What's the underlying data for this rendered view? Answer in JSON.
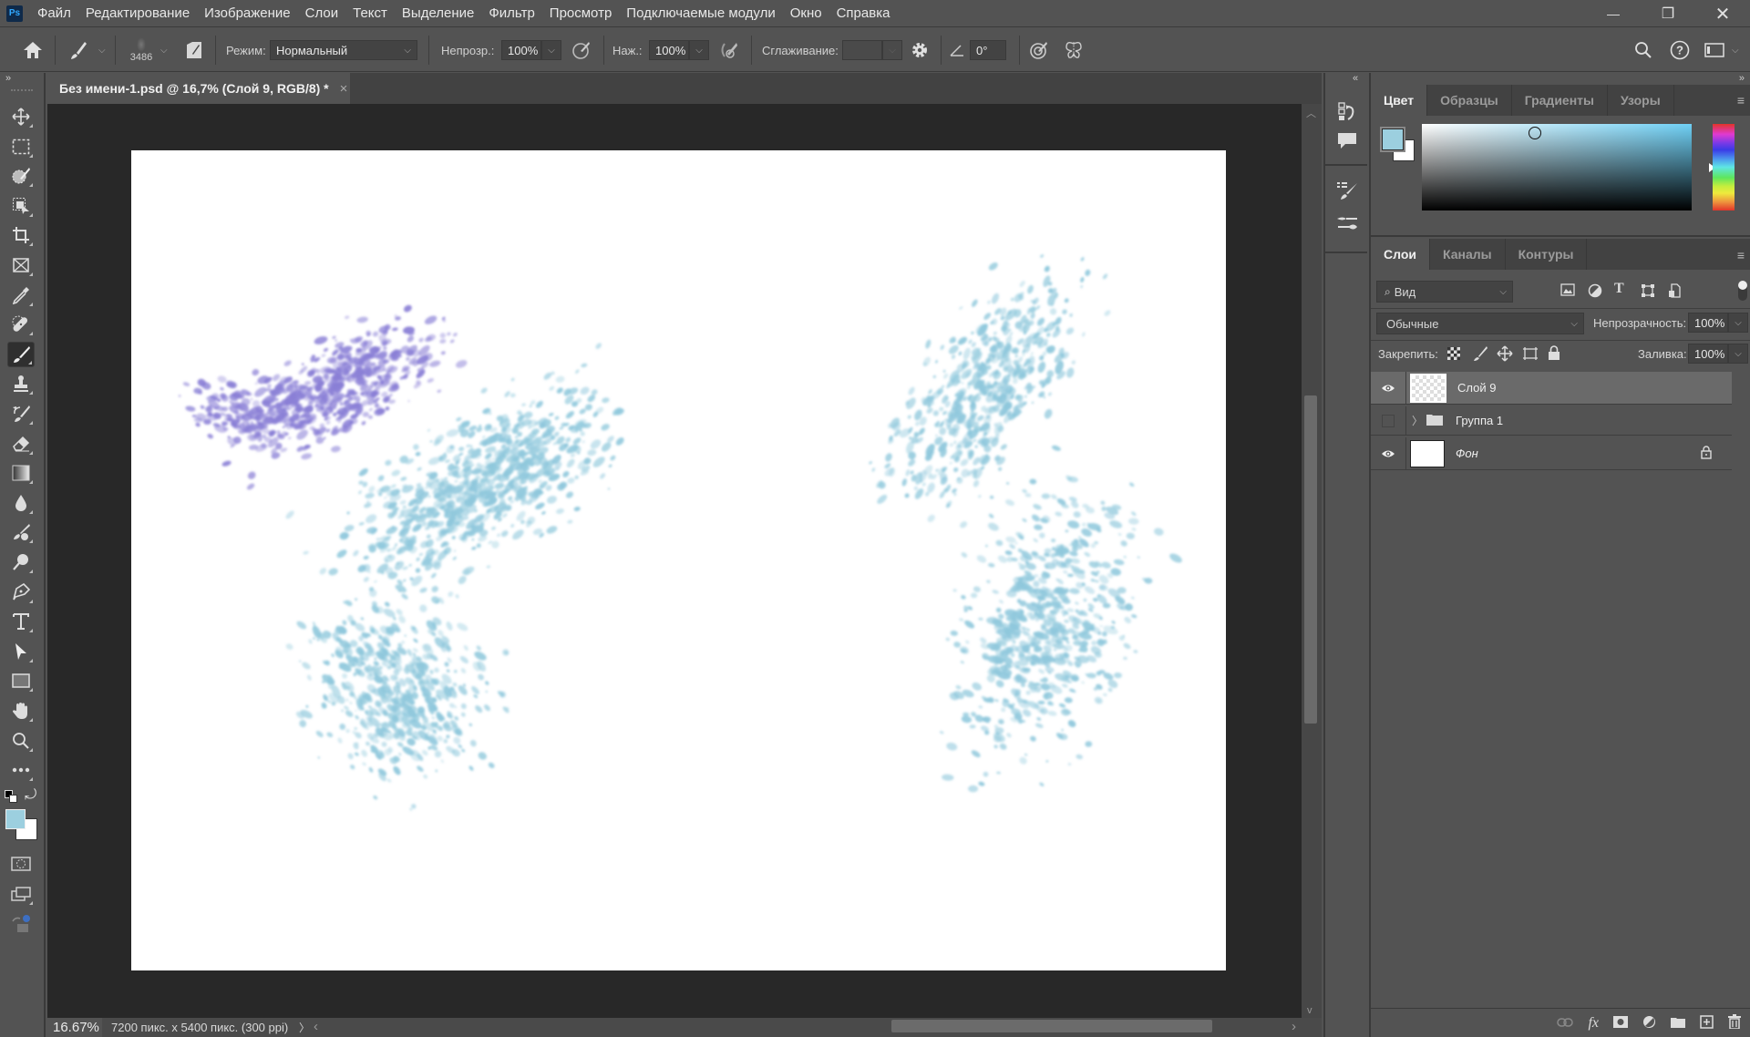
{
  "app": {
    "logo": "Ps"
  },
  "menu": [
    "Файл",
    "Редактирование",
    "Изображение",
    "Слои",
    "Текст",
    "Выделение",
    "Фильтр",
    "Просмотр",
    "Подключаемые модули",
    "Окно",
    "Справка"
  ],
  "window_controls": {
    "minimize": "—",
    "restore": "❐",
    "close": "✕"
  },
  "options_bar": {
    "brush_size": "3486",
    "mode_label": "Режим:",
    "mode_value": "Нормальный",
    "opacity_label": "Непрозр.:",
    "opacity_value": "100%",
    "flow_label": "Наж.:",
    "flow_value": "100%",
    "smoothing_label": "Сглаживание:",
    "smoothing_value": "",
    "angle_value": "0°"
  },
  "document": {
    "tab_title": "Без имени-1.psd @ 16,7% (Слой 9, RGB/8) *",
    "close": "×"
  },
  "status": {
    "zoom": "16.67%",
    "info": "7200 пикс. x 5400 пикс. (300 ppi)",
    "arrow": "〉",
    "left_arrow": "‹",
    "right_arrow": "›"
  },
  "collapse": {
    "left": "»",
    "right_panel_left": "«",
    "right_panel_right": "»"
  },
  "color_panel": {
    "tabs": [
      "Цвет",
      "Образцы",
      "Градиенты",
      "Узоры"
    ],
    "active_tab": 0,
    "foreground": "#9ccfdf",
    "background": "#ffffff",
    "hue_color": "#6fd0f5"
  },
  "layers_panel": {
    "tabs": [
      "Слои",
      "Каналы",
      "Контуры"
    ],
    "active_tab": 0,
    "filter_label": "Вид",
    "blend_mode": "Обычные",
    "opacity_label": "Непрозрачность:",
    "opacity_value": "100%",
    "lock_label": "Закрепить:",
    "fill_label": "Заливка:",
    "fill_value": "100%",
    "layers": [
      {
        "name": "Слой 9",
        "visible": true,
        "selected": true,
        "type": "pixel"
      },
      {
        "name": "Группа 1",
        "visible": false,
        "selected": false,
        "type": "group"
      },
      {
        "name": "Фон",
        "visible": true,
        "selected": false,
        "type": "background",
        "locked": true
      }
    ]
  },
  "canvas": {
    "paint_colors": {
      "purple": "#8a7fd6",
      "blue": "#8fc8dc"
    }
  }
}
